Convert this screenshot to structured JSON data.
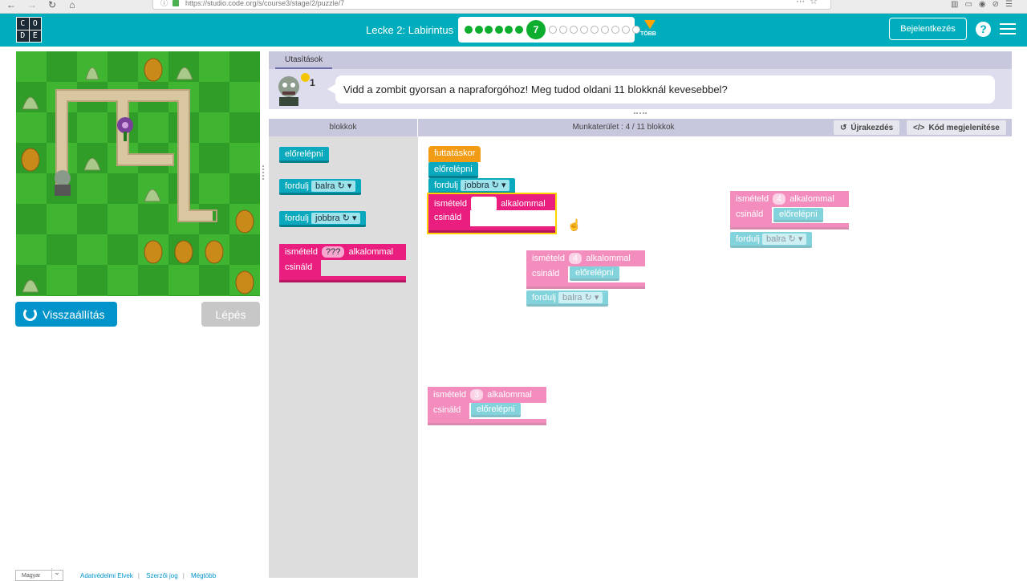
{
  "browser": {
    "url": "https://studio.code.org/s/course3/stage/2/puzzle/7",
    "url_display": "https://studio.code.org/s/course3/stage/2/puzzle/7"
  },
  "header": {
    "logo_letters": [
      "C",
      "O",
      "D",
      "E"
    ],
    "lesson_title": "Lecke 2: Labirintus",
    "current_puzzle": "7",
    "done_count": 6,
    "todo_count": 9,
    "more_label": "TÖBB",
    "signin_label": "Bejelentkezés",
    "help_label": "?"
  },
  "game": {
    "reset_label": "Visszaállítás",
    "step_label": "Lépés"
  },
  "footer": {
    "language": "Magyar",
    "links": [
      "Adatvédelmi Elvek",
      "Szerzői jog",
      "Mégtöbb"
    ]
  },
  "instructions": {
    "tab_label": "Utasítások",
    "hint_count": "1",
    "text": "Vidd a zombit gyorsan a napraforgóhoz! Meg tudod oldani 11 blokknál kevesebbel?"
  },
  "workspace": {
    "toolbox_title": "blokkok",
    "title": "Munkaterület : 4 / 11 blokkok",
    "restart_label": "Újrakezdés",
    "show_code_label": "Kód megjelenítése"
  },
  "toolbox_blocks": {
    "move": "előrelépni",
    "turn_left_prefix": "fordulj",
    "turn_left_value": "balra ↻ ▾",
    "turn_right_prefix": "fordulj",
    "turn_right_value": "jobbra ↻ ▾",
    "repeat_prefix": "ismételd",
    "repeat_value": "???",
    "repeat_suffix": "alkalommal",
    "repeat_do": "csináld"
  },
  "program_blocks": {
    "run": "futtatáskor",
    "move": "előrelépni",
    "turn_prefix": "fordulj",
    "turn_value": "jobbra ↻ ▾",
    "repeat_prefix": "ismételd",
    "repeat_suffix": "alkalommal",
    "repeat_do": "csináld"
  },
  "ghost_blocks": [
    {
      "prefix": "ismételd",
      "count": "4",
      "suffix": "alkalommal",
      "do": "csináld",
      "inner": "előrelépni",
      "after_prefix": "fordulj",
      "after_value": "balra ↻ ▾"
    },
    {
      "prefix": "ismételd",
      "count": "4",
      "suffix": "alkalommal",
      "do": "csináld",
      "inner": "előrelépni",
      "after_prefix": "fordulj",
      "after_value": "balra ↻ ▾"
    },
    {
      "prefix": "ismételd",
      "count": "3",
      "suffix": "alkalommal",
      "do": "csináld",
      "inner": "előrelépni"
    }
  ],
  "colors": {
    "header": "#00adbc",
    "move_block": "#0aa9bd",
    "repeat_block": "#e91e7f",
    "run_block": "#f29c15",
    "progress_done": "#0dad2e",
    "reset_button": "#0094ca"
  }
}
